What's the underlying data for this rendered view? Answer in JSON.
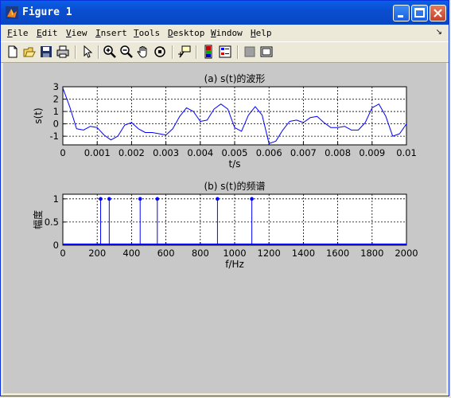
{
  "window": {
    "title": "Figure 1",
    "icon": "matlab-icon"
  },
  "menu": [
    {
      "label": "File",
      "key": "F"
    },
    {
      "label": "Edit",
      "key": "E"
    },
    {
      "label": "View",
      "key": "V"
    },
    {
      "label": "Insert",
      "key": "I"
    },
    {
      "label": "Tools",
      "key": "T"
    },
    {
      "label": "Desktop",
      "key": "D"
    },
    {
      "label": "Window",
      "key": "W"
    },
    {
      "label": "Help",
      "key": "H"
    }
  ],
  "toolbar": [
    "new-figure-icon",
    "open-file-icon",
    "save-icon",
    "print-icon",
    "edit-plot-arrow-icon",
    "zoom-in-icon",
    "zoom-out-icon",
    "pan-hand-icon",
    "rotate-3d-icon",
    "data-cursor-icon",
    "insert-colorbar-icon",
    "insert-legend-icon",
    "hide-plot-tools-icon",
    "show-plot-tools-icon"
  ],
  "colors": {
    "line": "#0000ff",
    "axes_bg": "#ffffff",
    "figure_bg": "#c8c8c8",
    "title_bar": "#0a4ed0"
  },
  "chart_data": [
    {
      "type": "line",
      "title": "(a) s(t)的波形",
      "xlabel": "t/s",
      "ylabel": "s(t)",
      "xlim": [
        0,
        0.01
      ],
      "ylim": [
        -1.7,
        3
      ],
      "xticks": [
        "0",
        "0.001",
        "0.002",
        "0.003",
        "0.004",
        "0.005",
        "0.006",
        "0.007",
        "0.008",
        "0.009",
        "0.01"
      ],
      "yticks": [
        "3",
        "2",
        "1",
        "0",
        "-1"
      ],
      "grid": true,
      "series": [
        {
          "x": [
            0,
            0.0002,
            0.0004,
            0.0006,
            0.0008,
            0.001,
            0.0012,
            0.0014,
            0.0016,
            0.0018,
            0.002,
            0.0022,
            0.0024,
            0.0026,
            0.0028,
            0.003,
            0.0032,
            0.0034,
            0.0036,
            0.0038,
            0.004,
            0.0042,
            0.0044,
            0.0046,
            0.0048,
            0.005,
            0.0052,
            0.0054,
            0.0056,
            0.0058,
            0.006,
            0.0062,
            0.0064,
            0.0066,
            0.0068,
            0.007,
            0.0072,
            0.0074,
            0.0076,
            0.0078,
            0.008,
            0.0082,
            0.0084,
            0.0086,
            0.0088,
            0.009,
            0.0092,
            0.0094,
            0.0096,
            0.0098,
            0.01
          ],
          "y": [
            2.9,
            1.4,
            -0.4,
            -0.5,
            -0.2,
            -0.3,
            -0.9,
            -1.3,
            -1.0,
            -0.1,
            0.1,
            -0.4,
            -0.7,
            -0.7,
            -0.8,
            -0.9,
            -0.4,
            0.6,
            1.3,
            1.0,
            0.2,
            0.3,
            1.2,
            1.6,
            1.2,
            -0.3,
            -0.6,
            0.7,
            1.4,
            0.7,
            -1.6,
            -1.4,
            -0.5,
            0.2,
            0.3,
            0.1,
            0.5,
            0.6,
            0.1,
            -0.3,
            -0.3,
            -0.2,
            -0.5,
            -0.5,
            0.1,
            1.3,
            1.6,
            0.6,
            -1.0,
            -0.8,
            0.0
          ]
        }
      ]
    },
    {
      "type": "stem",
      "title": "(b) s(t)的频谱",
      "xlabel": "f/Hz",
      "ylabel": "幅度",
      "xlim": [
        0,
        2000
      ],
      "ylim": [
        0,
        1.1
      ],
      "xticks": [
        "0",
        "200",
        "400",
        "600",
        "800",
        "1000",
        "1200",
        "1400",
        "1600",
        "1800",
        "2000"
      ],
      "yticks": [
        "1",
        "0.5",
        "0"
      ],
      "grid": true,
      "series": [
        {
          "x": [
            220,
            270,
            450,
            550,
            900,
            1100
          ],
          "y": [
            1,
            1,
            1,
            1,
            1,
            1
          ]
        }
      ]
    }
  ]
}
